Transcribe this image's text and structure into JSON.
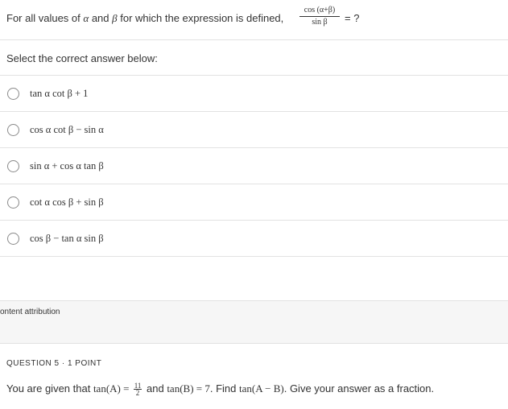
{
  "question": {
    "prefix_1": "For all values of ",
    "alpha": "α",
    "and_1": " and ",
    "beta": "β",
    "suffix": " for which the expression is defined,",
    "fraction_numerator": "cos (α+β)",
    "fraction_denominator": "sin β",
    "tail": "= ?"
  },
  "instruction": "Select the correct answer below:",
  "options": [
    {
      "label": "tan α cot β + 1"
    },
    {
      "label": "cos α cot β − sin α"
    },
    {
      "label": "sin α + cos α tan β"
    },
    {
      "label": "cot α cos β + sin β"
    },
    {
      "label": "cos β − tan α sin β"
    }
  ],
  "attribution": "ontent attribution",
  "question5": {
    "header": "QUESTION 5 · 1 POINT",
    "prefix": "You are given that ",
    "tanA": "tan(A)",
    "eq1": " = ",
    "frac_num": "11",
    "frac_den": "2",
    "and": " and ",
    "tanB": "tan(B)",
    "eq2": " = 7",
    "find": ". Find ",
    "tanAB": "tan(A − B)",
    "end": ". Give your answer as a fraction."
  }
}
